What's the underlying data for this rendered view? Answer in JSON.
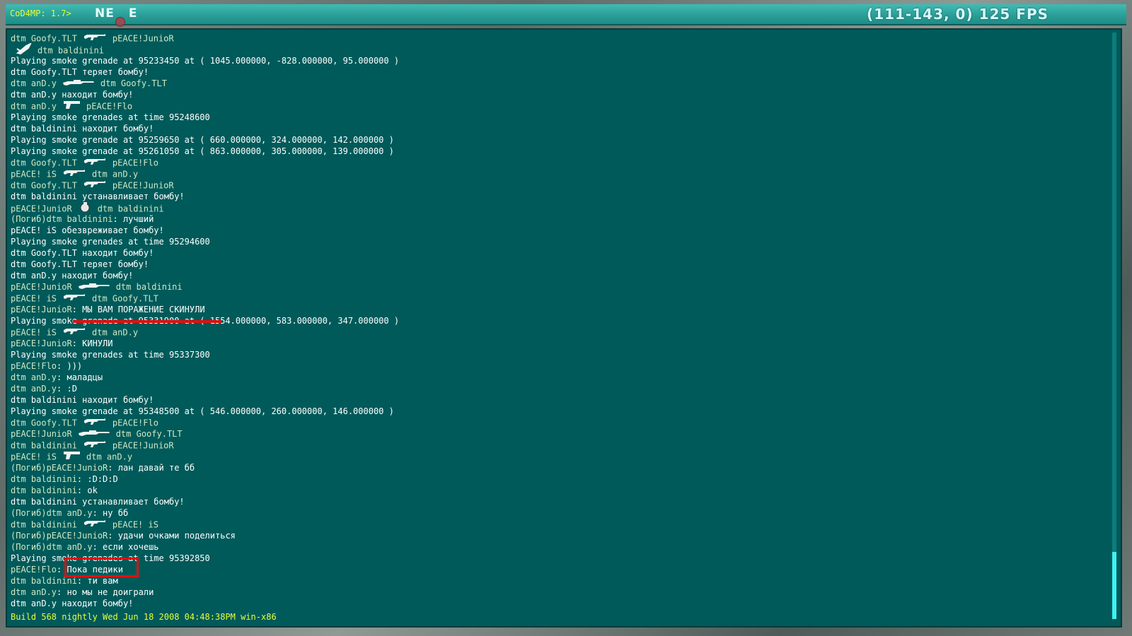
{
  "topbar": {
    "prompt": "CoD4MP: 1.7>",
    "compass": [
      "NE",
      "E"
    ],
    "fps": "(111-143, 0) 125 FPS"
  },
  "console": {
    "lines": [
      {
        "type": "kill",
        "killer": "dtm Goofy.TLT",
        "weapon": "rifle-icon",
        "victim": "pEACE!JunioR"
      },
      {
        "type": "kill",
        "killer": "",
        "weapon": "knife-icon",
        "victim": "dtm baldinini"
      },
      {
        "type": "text",
        "text": "Playing smoke grenade at 95233450 at ( 1045.000000, -828.000000, 95.000000 )"
      },
      {
        "type": "text",
        "text": "dtm Goofy.TLT теряет бомбу!"
      },
      {
        "type": "kill",
        "killer": "dtm anD.y",
        "weapon": "sniper-icon",
        "victim": "dtm Goofy.TLT"
      },
      {
        "type": "text",
        "text": "dtm anD.y находит бомбу!"
      },
      {
        "type": "kill",
        "killer": "dtm anD.y",
        "weapon": "pistol-icon",
        "victim": "pEACE!Flo"
      },
      {
        "type": "text",
        "text": "Playing smoke grenades at time 95248600"
      },
      {
        "type": "text",
        "text": "dtm baldinini находит бомбу!"
      },
      {
        "type": "text",
        "text": "Playing smoke grenade at 95259650 at ( 660.000000, 324.000000, 142.000000 )"
      },
      {
        "type": "text",
        "text": "Playing smoke grenade at 95261050 at ( 863.000000, 305.000000, 139.000000 )"
      },
      {
        "type": "kill",
        "killer": "dtm Goofy.TLT",
        "weapon": "rifle-icon",
        "victim": "pEACE!Flo"
      },
      {
        "type": "kill",
        "killer": "pEACE! iS",
        "weapon": "rifle-icon",
        "victim": "dtm anD.y"
      },
      {
        "type": "kill",
        "killer": "dtm Goofy.TLT",
        "weapon": "rifle-icon",
        "victim": "pEACE!JunioR"
      },
      {
        "type": "text",
        "text": "dtm baldinini устанавливает бомбу!"
      },
      {
        "type": "kill",
        "killer": "pEACE!JunioR",
        "weapon": "grenade-icon",
        "victim": "dtm baldinini"
      },
      {
        "type": "chat",
        "name": "(Погиб)dtm baldinini",
        "msg": "лучший"
      },
      {
        "type": "text",
        "text": "pEACE! iS обезвреживает бомбу!"
      },
      {
        "type": "text",
        "text": "Playing smoke grenades at time 95294600"
      },
      {
        "type": "text",
        "text": "dtm Goofy.TLT находит бомбу!"
      },
      {
        "type": "text",
        "text": "dtm Goofy.TLT теряет бомбу!"
      },
      {
        "type": "text",
        "text": "dtm anD.y находит бомбу!"
      },
      {
        "type": "kill",
        "killer": "pEACE!JunioR",
        "weapon": "sniper-icon",
        "victim": "dtm baldinini"
      },
      {
        "type": "kill",
        "killer": "pEACE! iS",
        "weapon": "rifle-icon",
        "victim": "dtm Goofy.TLT"
      },
      {
        "type": "chat",
        "name": "pEACE!JunioR",
        "msg": "МЫ ВАМ ПОРАЖЕНИЕ СКИНУЛИ"
      },
      {
        "type": "text",
        "text": "Playing smoke grenade at 95331900 at ( 1554.000000, 583.000000, 347.000000 )"
      },
      {
        "type": "kill",
        "killer": "pEACE! iS",
        "weapon": "rifle-icon",
        "victim": "dtm anD.y"
      },
      {
        "type": "chat",
        "name": "pEACE!JunioR",
        "msg": "КИНУЛИ"
      },
      {
        "type": "text",
        "text": "Playing smoke grenades at time 95337300"
      },
      {
        "type": "chat",
        "name": "pEACE!Flo",
        "msg": ")))"
      },
      {
        "type": "chat",
        "name": "dtm anD.y",
        "msg": "маладцы"
      },
      {
        "type": "chat",
        "name": "dtm anD.y",
        "msg": ":D"
      },
      {
        "type": "text",
        "text": "dtm baldinini находит бомбу!"
      },
      {
        "type": "text",
        "text": "Playing smoke grenade at 95348500 at ( 546.000000, 260.000000, 146.000000 )"
      },
      {
        "type": "kill",
        "killer": "dtm Goofy.TLT",
        "weapon": "rifle-icon",
        "victim": "pEACE!Flo"
      },
      {
        "type": "kill",
        "killer": "pEACE!JunioR",
        "weapon": "sniper-icon",
        "victim": "dtm Goofy.TLT"
      },
      {
        "type": "kill",
        "killer": "dtm baldinini",
        "weapon": "rifle-icon",
        "victim": "pEACE!JunioR"
      },
      {
        "type": "kill",
        "killer": "pEACE! iS",
        "weapon": "pistol-icon",
        "victim": "dtm anD.y"
      },
      {
        "type": "chat",
        "name": "(Погиб)pEACE!JunioR",
        "msg": "лан давай те бб"
      },
      {
        "type": "chat",
        "name": "dtm baldinini",
        "msg": ":D:D:D"
      },
      {
        "type": "chat",
        "name": "dtm baldinini",
        "msg": "ok"
      },
      {
        "type": "text",
        "text": "dtm baldinini устанавливает бомбу!"
      },
      {
        "type": "chat",
        "name": "(Погиб)dtm anD.y",
        "msg": "ну бб"
      },
      {
        "type": "kill",
        "killer": "dtm baldinini",
        "weapon": "rifle-icon",
        "victim": "pEACE! iS"
      },
      {
        "type": "chat",
        "name": "(Погиб)pEACE!JunioR",
        "msg": "удачи очками поделиться"
      },
      {
        "type": "chat",
        "name": "(Погиб)dtm anD.y",
        "msg": "если хочешь"
      },
      {
        "type": "text",
        "text": "Playing smoke grenades at time 95392850"
      },
      {
        "type": "chat",
        "name": "pEACE!Flo",
        "msg": "Пока педики"
      },
      {
        "type": "chat",
        "name": "dtm baldinini",
        "msg": "ти вам"
      },
      {
        "type": "chat",
        "name": "dtm anD.y",
        "msg": "но мы не доиграли"
      },
      {
        "type": "text",
        "text": "dtm anD.y находит бомбу!"
      }
    ],
    "status": "Build 568 nightly Wed Jun 18 2008 04:48:38PM win-x86"
  },
  "colors": {
    "console_bg": "#005a5a",
    "name": "#cfe8c4",
    "text": "#ffffff",
    "status": "#e3ff3a",
    "annotation": "#e01010"
  }
}
